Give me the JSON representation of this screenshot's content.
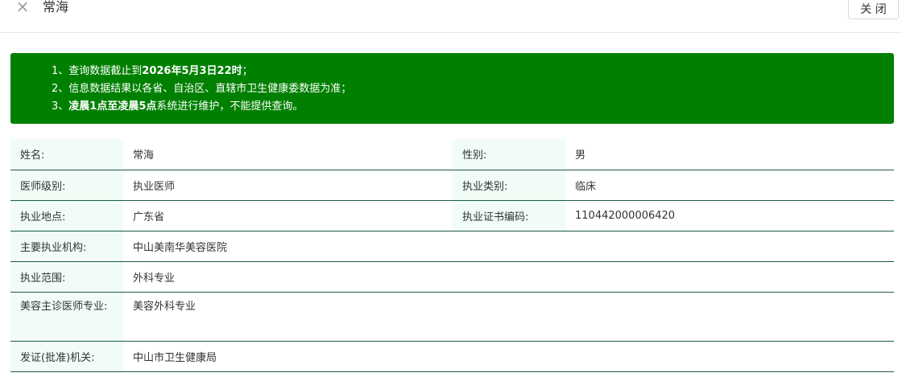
{
  "header": {
    "close_icon": "×",
    "title": "常海",
    "close_button": "关 闭"
  },
  "notice": {
    "line1_prefix": "1、查询数据截止到",
    "line1_bold": "2026年5月3日22时",
    "line1_suffix": "；",
    "line2": "2、信息数据结果以各省、自治区、直辖市卫生健康委数据为准；",
    "line3_prefix": "3、",
    "line3_bold": "凌晨1点至凌晨5点",
    "line3_suffix": "系统进行维护，不能提供查询。",
    "background_color": "#008000"
  },
  "info": {
    "name_label": "姓名:",
    "name_value": "常海",
    "gender_label": "性别:",
    "gender_value": "男",
    "level_label": "医师级别:",
    "level_value": "执业医师",
    "category_label": "执业类别:",
    "category_value": "临床",
    "location_label": "执业地点:",
    "location_value": "广东省",
    "cert_label": "执业证书编码:",
    "cert_value": "110442000006420",
    "org_label": "主要执业机构:",
    "org_value": "中山美南华美容医院",
    "scope_label": "执业范围:",
    "scope_value": "外科专业",
    "cosmetic_label": "美容主诊医师专业:",
    "cosmetic_value": "美容外科专业",
    "authority_label": "发证(批准)机关:",
    "authority_value": "中山市卫生健康局"
  }
}
